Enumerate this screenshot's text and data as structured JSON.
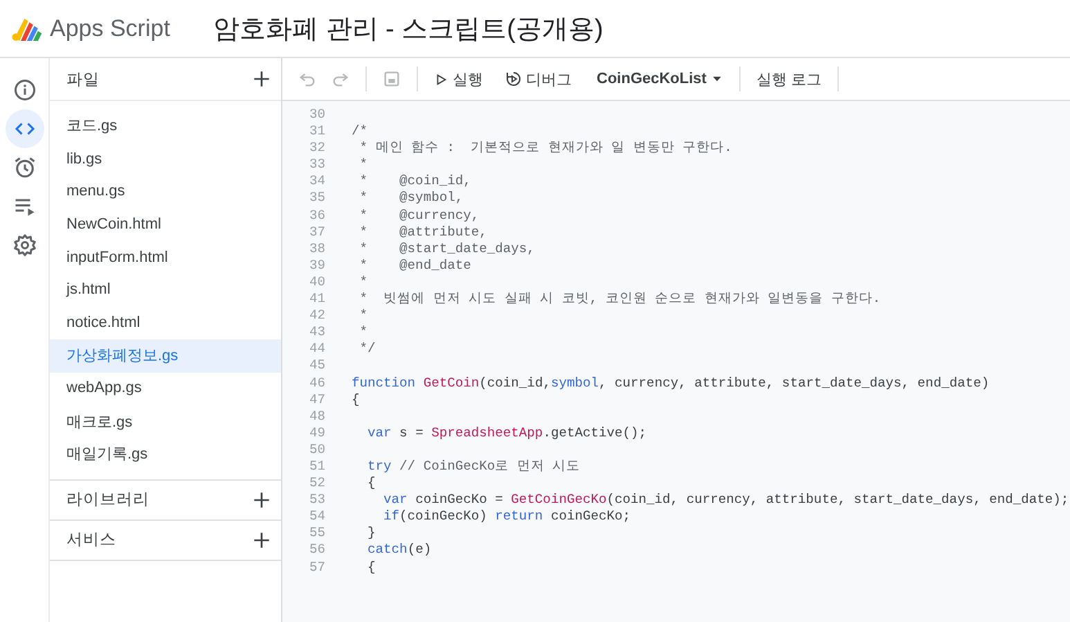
{
  "header": {
    "product": "Apps Script",
    "title": "암호화폐 관리 - 스크립트(공개용)"
  },
  "rail": [
    {
      "kind": "info",
      "selected": false
    },
    {
      "kind": "code",
      "selected": true
    },
    {
      "kind": "triggers",
      "selected": false
    },
    {
      "kind": "executions",
      "selected": false
    },
    {
      "kind": "settings",
      "selected": false
    }
  ],
  "files_panel": {
    "title": "파일",
    "files": [
      {
        "name": "코드.gs",
        "selected": false
      },
      {
        "name": "lib.gs",
        "selected": false
      },
      {
        "name": "menu.gs",
        "selected": false
      },
      {
        "name": "NewCoin.html",
        "selected": false
      },
      {
        "name": "inputForm.html",
        "selected": false
      },
      {
        "name": "js.html",
        "selected": false
      },
      {
        "name": "notice.html",
        "selected": false
      },
      {
        "name": "가상화폐정보.gs",
        "selected": true
      },
      {
        "name": "webApp.gs",
        "selected": false
      },
      {
        "name": "매크로.gs",
        "selected": false
      },
      {
        "name": "매일기록.gs",
        "selected": false
      }
    ],
    "sections": [
      "라이브러리",
      "서비스"
    ]
  },
  "toolbar": {
    "undo_disabled": true,
    "redo_disabled": true,
    "save_disabled": true,
    "run": "실행",
    "debug": "디버그",
    "function_select": "CoinGecKoList",
    "log": "실행 로그"
  },
  "code": [
    {
      "number": "30"
    },
    {
      "number": "31",
      "tokens": [
        {
          "kind": "comment",
          "text": "/*"
        }
      ]
    },
    {
      "number": "32",
      "tokens": [
        {
          "kind": "comment",
          "text": " * 메인 함수 :  기본적으로 현재가와 일 변동만 구한다."
        }
      ]
    },
    {
      "number": "33",
      "tokens": [
        {
          "kind": "comment",
          "text": " *"
        }
      ]
    },
    {
      "number": "34",
      "tokens": [
        {
          "kind": "comment",
          "text": " *    @coin_id,"
        }
      ]
    },
    {
      "number": "35",
      "tokens": [
        {
          "kind": "comment",
          "text": " *    @symbol,"
        }
      ]
    },
    {
      "number": "36",
      "tokens": [
        {
          "kind": "comment",
          "text": " *    @currency,"
        }
      ]
    },
    {
      "number": "37",
      "tokens": [
        {
          "kind": "comment",
          "text": " *    @attribute,"
        }
      ]
    },
    {
      "number": "38",
      "tokens": [
        {
          "kind": "comment",
          "text": " *    @start_date_days,"
        }
      ]
    },
    {
      "number": "39",
      "tokens": [
        {
          "kind": "comment",
          "text": " *    @end_date"
        }
      ]
    },
    {
      "number": "40",
      "tokens": [
        {
          "kind": "comment",
          "text": " *"
        }
      ]
    },
    {
      "number": "41",
      "tokens": [
        {
          "kind": "comment",
          "text": " *  빗썸에 먼저 시도 실패 시 코빗, 코인원 순으로 현재가와 일변동을 구한다."
        }
      ]
    },
    {
      "number": "42",
      "tokens": [
        {
          "kind": "comment",
          "text": " *"
        }
      ]
    },
    {
      "number": "43",
      "tokens": [
        {
          "kind": "comment",
          "text": " *"
        }
      ]
    },
    {
      "number": "44",
      "tokens": [
        {
          "kind": "comment",
          "text": " */"
        }
      ]
    },
    {
      "number": "45"
    },
    {
      "number": "46",
      "tokens": [
        {
          "kind": "keyword",
          "text": "function "
        },
        {
          "kind": "name",
          "text": "GetCoin"
        },
        {
          "kind": "plain",
          "text": "(coin_id,"
        },
        {
          "kind": "keyword",
          "text": "symbol"
        },
        {
          "kind": "plain",
          "text": ", currency, attribute, start_date_days, end_date)"
        }
      ]
    },
    {
      "number": "47",
      "tokens": [
        {
          "kind": "plain",
          "text": "{"
        }
      ]
    },
    {
      "number": "48"
    },
    {
      "number": "49",
      "tokens": [
        {
          "kind": "keyword",
          "text": "  var"
        },
        {
          "kind": "plain",
          "text": " s = "
        },
        {
          "kind": "name",
          "text": "SpreadsheetApp"
        },
        {
          "kind": "plain",
          "text": ".getActive();"
        }
      ]
    },
    {
      "number": "50"
    },
    {
      "number": "51",
      "tokens": [
        {
          "kind": "keyword",
          "text": "  try "
        },
        {
          "kind": "comment",
          "text": "// CoinGecKo로 먼저 시도"
        }
      ]
    },
    {
      "number": "52",
      "tokens": [
        {
          "kind": "plain",
          "text": "  {"
        }
      ]
    },
    {
      "number": "53",
      "tokens": [
        {
          "kind": "keyword",
          "text": "    var"
        },
        {
          "kind": "plain",
          "text": " coinGecKo = "
        },
        {
          "kind": "name",
          "text": "GetCoinGecKo"
        },
        {
          "kind": "plain",
          "text": "(coin_id, currency, attribute, start_date_days, end_date);"
        }
      ]
    },
    {
      "number": "54",
      "tokens": [
        {
          "kind": "keyword",
          "text": "    if"
        },
        {
          "kind": "plain",
          "text": "(coinGecKo) "
        },
        {
          "kind": "keyword",
          "text": "return"
        },
        {
          "kind": "plain",
          "text": " coinGecKo;"
        }
      ]
    },
    {
      "number": "55",
      "tokens": [
        {
          "kind": "plain",
          "text": "  }"
        }
      ]
    },
    {
      "number": "56",
      "tokens": [
        {
          "kind": "keyword",
          "text": "  catch"
        },
        {
          "kind": "plain",
          "text": "(e)"
        }
      ]
    },
    {
      "number": "57",
      "tokens": [
        {
          "kind": "plain",
          "text": "  {"
        }
      ]
    }
  ]
}
